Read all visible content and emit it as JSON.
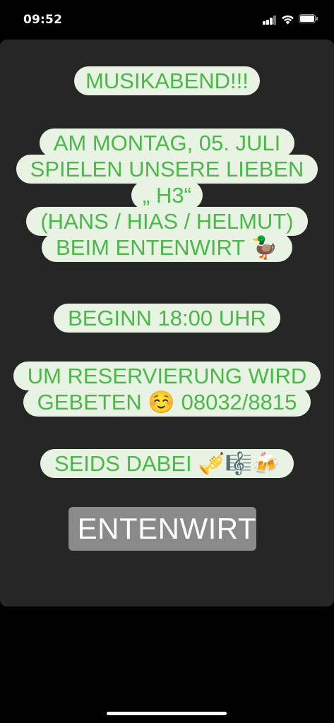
{
  "status_bar": {
    "time": "09:52"
  },
  "story": {
    "title": "MUSIKABEND!!!",
    "announcement_lines": [
      "AM MONTAG, 05. JULI",
      "SPIELEN UNSERE LIEBEN",
      "„ H3“",
      "(HANS / HIAS / HELMUT)",
      "BEIM ENTENWIRT 🦆"
    ],
    "start_time": "BEGINN 18:00 UHR",
    "reservation_lines": [
      "UM RESERVIERUNG WIRD",
      "GEBETEN ☺️ 08032/8815"
    ],
    "closing": "SEIDS DABEI 🎺🎼🍻",
    "location_sticker": "ENTENWIRT"
  },
  "colors": {
    "pill_background": "#e8f3e4",
    "pill_text": "#4bb849",
    "story_background": "#262626",
    "sticker_background": "#8a8a8a"
  }
}
